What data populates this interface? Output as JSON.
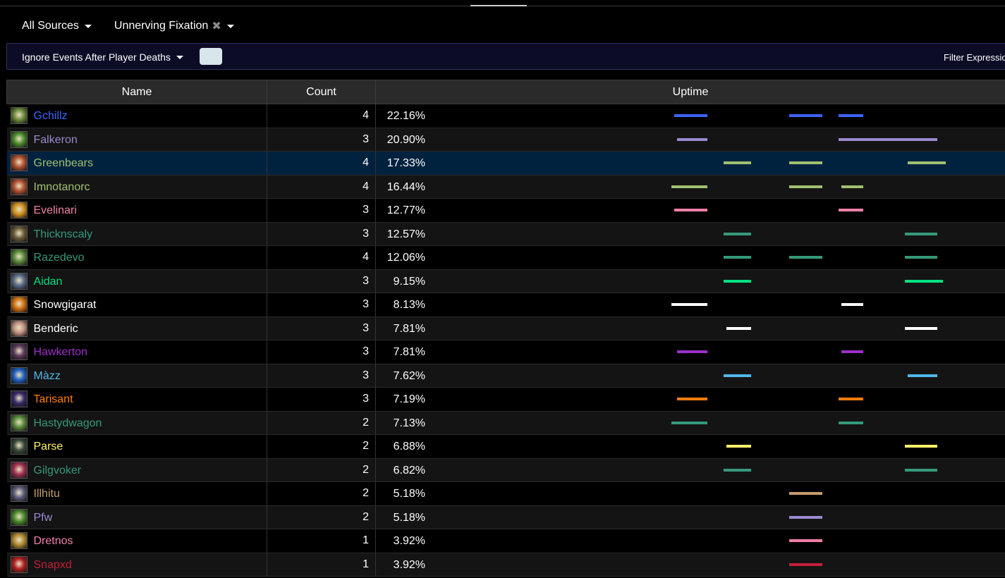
{
  "filters": {
    "source_label": "All Sources",
    "ability_label": "Unnerving Fixation"
  },
  "toolbar": {
    "ignore_label": "Ignore Events After Player Deaths",
    "filter_label": "Filter Expression"
  },
  "table": {
    "headers": {
      "name": "Name",
      "count": "Count",
      "uptime": "Uptime"
    },
    "rows": [
      {
        "name": "Gchillz",
        "count": "4",
        "uptime": "22.16%",
        "color": "#3c64ff",
        "icon": "hunter-icon",
        "icon_color": "#6a8a3a",
        "bars": [
          [
            0.0,
            0.12
          ],
          [
            0.42,
            0.54
          ],
          [
            0.6,
            0.69
          ]
        ]
      },
      {
        "name": "Falkeron",
        "count": "3",
        "uptime": "20.90%",
        "color": "#9b8ad0",
        "icon": "druid-icon",
        "icon_color": "#4a8a2a",
        "bars": [
          [
            0.01,
            0.12
          ],
          [
            0.6,
            0.96
          ]
        ]
      },
      {
        "name": "Greenbears",
        "count": "4",
        "uptime": "17.33%",
        "color": "#a0c070",
        "icon": "warrior-icon",
        "icon_color": "#b05030",
        "bars": [
          [
            0.18,
            0.28
          ],
          [
            0.42,
            0.54
          ],
          [
            0.85,
            0.99
          ]
        ]
      },
      {
        "name": "Imnotanorc",
        "count": "4",
        "uptime": "16.44%",
        "color": "#a0c070",
        "icon": "warrior-icon",
        "icon_color": "#b05030",
        "bars": [
          [
            -0.01,
            0.12
          ],
          [
            0.42,
            0.54
          ],
          [
            0.61,
            0.69
          ]
        ]
      },
      {
        "name": "Evelinari",
        "count": "3",
        "uptime": "12.77%",
        "color": "#f080a8",
        "icon": "paladin-icon",
        "icon_color": "#d09020",
        "bars": [
          [
            0.0,
            0.12
          ],
          [
            0.6,
            0.69
          ]
        ]
      },
      {
        "name": "Thicknscaly",
        "count": "3",
        "uptime": "12.57%",
        "color": "#34997a",
        "icon": "evoker-icon",
        "icon_color": "#6a5a3a",
        "bars": [
          [
            0.18,
            0.28
          ],
          [
            0.84,
            0.96
          ]
        ]
      },
      {
        "name": "Razedevo",
        "count": "4",
        "uptime": "12.06%",
        "color": "#34997a",
        "icon": "evoker-icon",
        "icon_color": "#5a8a3a",
        "bars": [
          [
            0.18,
            0.28
          ],
          [
            0.42,
            0.54
          ],
          [
            0.84,
            0.96
          ]
        ]
      },
      {
        "name": "Aidan",
        "count": "3",
        "uptime": "9.15%",
        "color": "#00e080",
        "icon": "monk-icon",
        "icon_color": "#5a6a8a",
        "bars": [
          [
            0.18,
            0.28
          ],
          [
            0.84,
            0.98
          ]
        ]
      },
      {
        "name": "Snowgigarat",
        "count": "3",
        "uptime": "8.13%",
        "color": "#ffffff",
        "icon": "priest-icon",
        "icon_color": "#d07010",
        "bars": [
          [
            -0.01,
            0.12
          ],
          [
            0.61,
            0.69
          ]
        ]
      },
      {
        "name": "Benderic",
        "count": "3",
        "uptime": "7.81%",
        "color": "#ffffff",
        "icon": "priest-icon",
        "icon_color": "#c09080",
        "bars": [
          [
            0.19,
            0.28
          ],
          [
            0.84,
            0.96
          ]
        ]
      },
      {
        "name": "Hawkerton",
        "count": "3",
        "uptime": "7.81%",
        "color": "#9b30c8",
        "icon": "warlock-icon",
        "icon_color": "#5a3a5a",
        "bars": [
          [
            0.01,
            0.12
          ],
          [
            0.61,
            0.69
          ]
        ]
      },
      {
        "name": "Màzz",
        "count": "3",
        "uptime": "7.62%",
        "color": "#50b8e8",
        "icon": "mage-icon",
        "icon_color": "#2060c0",
        "bars": [
          [
            0.18,
            0.28
          ],
          [
            0.85,
            0.96
          ]
        ]
      },
      {
        "name": "Tarisant",
        "count": "3",
        "uptime": "7.19%",
        "color": "#ff7c0a",
        "icon": "druid-icon",
        "icon_color": "#3a2a6a",
        "bars": [
          [
            0.01,
            0.12
          ],
          [
            0.6,
            0.69
          ]
        ]
      },
      {
        "name": "Hastydwagon",
        "count": "2",
        "uptime": "7.13%",
        "color": "#34997a",
        "icon": "evoker-icon",
        "icon_color": "#5a8a3a",
        "bars": [
          [
            -0.01,
            0.12
          ],
          [
            0.6,
            0.69
          ]
        ]
      },
      {
        "name": "Parse",
        "count": "2",
        "uptime": "6.88%",
        "color": "#fff06a",
        "icon": "rogue-icon",
        "icon_color": "#3a4a3a",
        "bars": [
          [
            0.19,
            0.28
          ],
          [
            0.84,
            0.96
          ]
        ]
      },
      {
        "name": "Gilgvoker",
        "count": "2",
        "uptime": "6.82%",
        "color": "#34997a",
        "icon": "evoker-icon",
        "icon_color": "#a03050",
        "bars": [
          [
            0.18,
            0.28
          ],
          [
            0.84,
            0.96
          ]
        ]
      },
      {
        "name": "Illhitu",
        "count": "2",
        "uptime": "5.18%",
        "color": "#c69b6d",
        "icon": "warrior-icon",
        "icon_color": "#5a5a7a",
        "bars": [
          [
            0.42,
            0.54
          ]
        ]
      },
      {
        "name": "Pfw",
        "count": "2",
        "uptime": "5.18%",
        "color": "#9b8ad0",
        "icon": "druid-icon",
        "icon_color": "#4a8a2a",
        "bars": [
          [
            0.42,
            0.54
          ]
        ]
      },
      {
        "name": "Dretnos",
        "count": "1",
        "uptime": "3.92%",
        "color": "#f080a8",
        "icon": "paladin-icon",
        "icon_color": "#b08a30",
        "bars": [
          [
            0.42,
            0.54
          ]
        ]
      },
      {
        "name": "Snapxd",
        "count": "1",
        "uptime": "3.92%",
        "color": "#c41e3a",
        "icon": "deathknight-icon",
        "icon_color": "#b02020",
        "bars": [
          [
            0.42,
            0.54
          ]
        ]
      }
    ]
  }
}
